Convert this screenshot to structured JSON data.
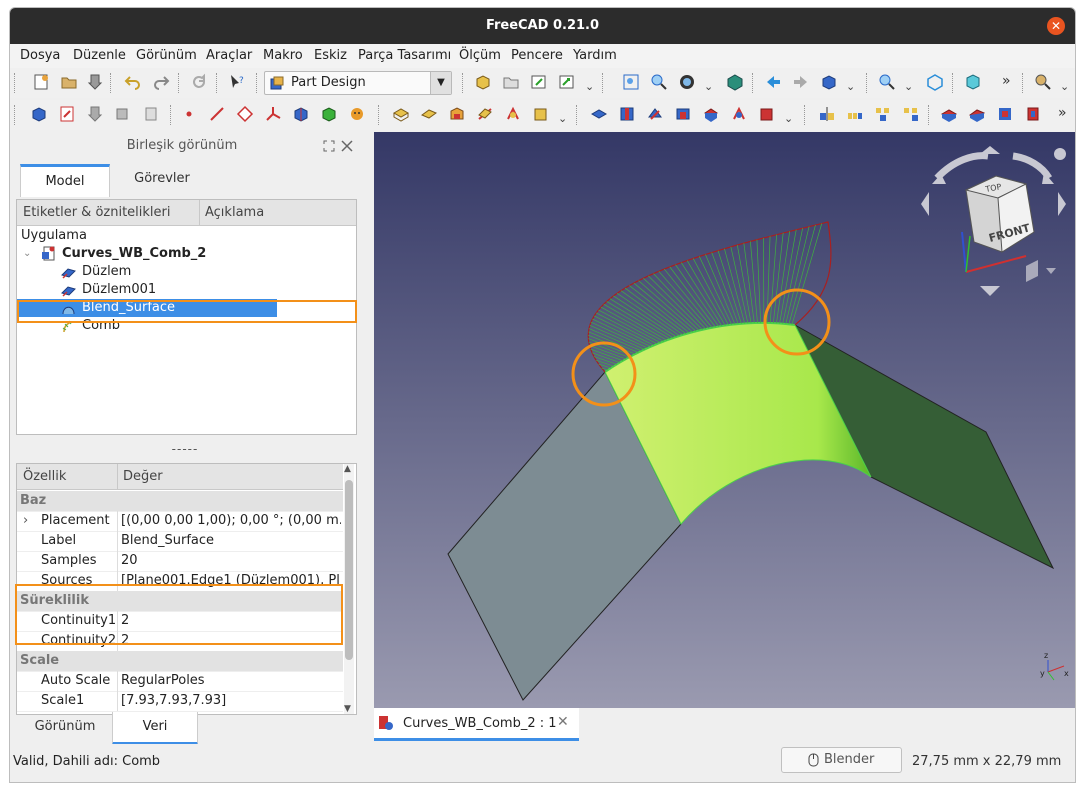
{
  "window": {
    "title": "FreeCAD 0.21.0"
  },
  "menu": [
    "Dosya",
    "Düzenle",
    "Görünüm",
    "Araçlar",
    "Makro",
    "Eskiz",
    "Parça Tasarımı",
    "Ölçüm",
    "Pencere",
    "Yardım"
  ],
  "toolbar": {
    "workbench": "Part Design",
    "overflow": "»"
  },
  "panel": {
    "title": "Birleşik görünüm",
    "tabs": [
      "Model",
      "Görevler"
    ],
    "tree_header": [
      "Etiketler & öznitelikleri",
      "Açıklama"
    ],
    "tree": {
      "root": "Uygulama",
      "document": "Curves_WB_Comb_2",
      "items": [
        "Düzlem",
        "Düzlem001",
        "Blend_Surface",
        "Comb"
      ]
    },
    "splitter": "-----",
    "prop_header": [
      "Özellik",
      "Değer"
    ],
    "props": {
      "group_base": "Baz",
      "placement_name": "Placement",
      "placement_val": "[(0,00 0,00 1,00); 0,00 °; (0,00 m...",
      "label_name": "Label",
      "label_val": "Blend_Surface",
      "samples_name": "Samples",
      "samples_val": "20",
      "sources_name": "Sources",
      "sources_val": "[Plane001.Edge1 (Düzlem001), Pl...",
      "group_continuity": "Süreklilik",
      "cont1_name": "Continuity1",
      "cont1_val": "2",
      "cont2_name": "Continuity2",
      "cont2_val": "2",
      "group_scale": "Scale",
      "autoscale_name": "Auto Scale",
      "autoscale_val": "RegularPoles",
      "scale1_name": "Scale1",
      "scale1_val": "[7.93,7.93,7.93]"
    },
    "bottom_tabs": [
      "Görünüm",
      "Veri"
    ]
  },
  "document_tab": "Curves_WB_Comb_2 : 1",
  "navcube": {
    "top": "TOP",
    "front": "FRONT"
  },
  "axis": {
    "z": "z",
    "y": "y",
    "x": "x"
  },
  "status": {
    "message": "Valid, Dahili adı: Comb",
    "nav_style": "Blender",
    "dimensions": "27,75 mm x 22,79 mm"
  },
  "colors": {
    "accent": "#e95420",
    "highlight": "#f39019",
    "selection": "#3d8ee6",
    "surface": "#a8e84b"
  }
}
